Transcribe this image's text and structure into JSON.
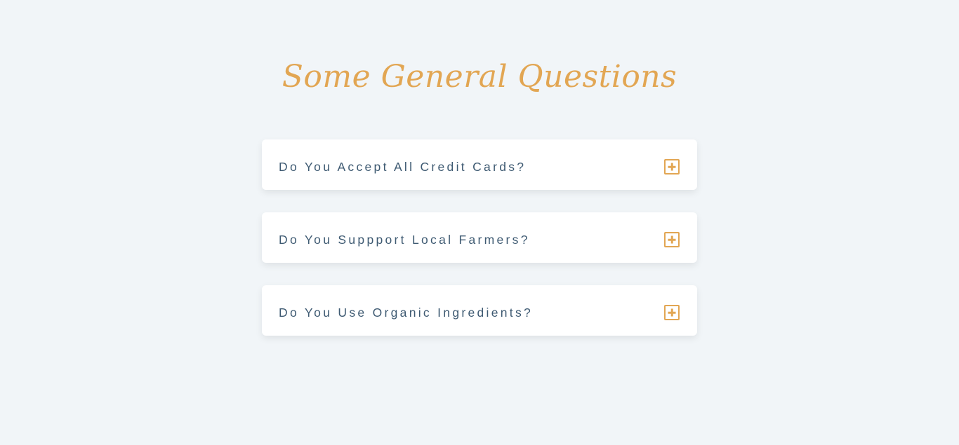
{
  "page": {
    "title": "Some General Questions"
  },
  "colors": {
    "background": "#f1f5f8",
    "accent": "#e2a653",
    "question_text": "#3e5a72",
    "card": "#ffffff"
  },
  "faq": {
    "items": [
      {
        "question": "Do You Accept All Credit Cards?",
        "icon": "plus-square-icon",
        "expanded": false
      },
      {
        "question": "Do You Suppport Local Farmers?",
        "icon": "plus-square-icon",
        "expanded": false
      },
      {
        "question": "Do You Use Organic Ingredients?",
        "icon": "plus-square-icon",
        "expanded": false
      }
    ]
  }
}
